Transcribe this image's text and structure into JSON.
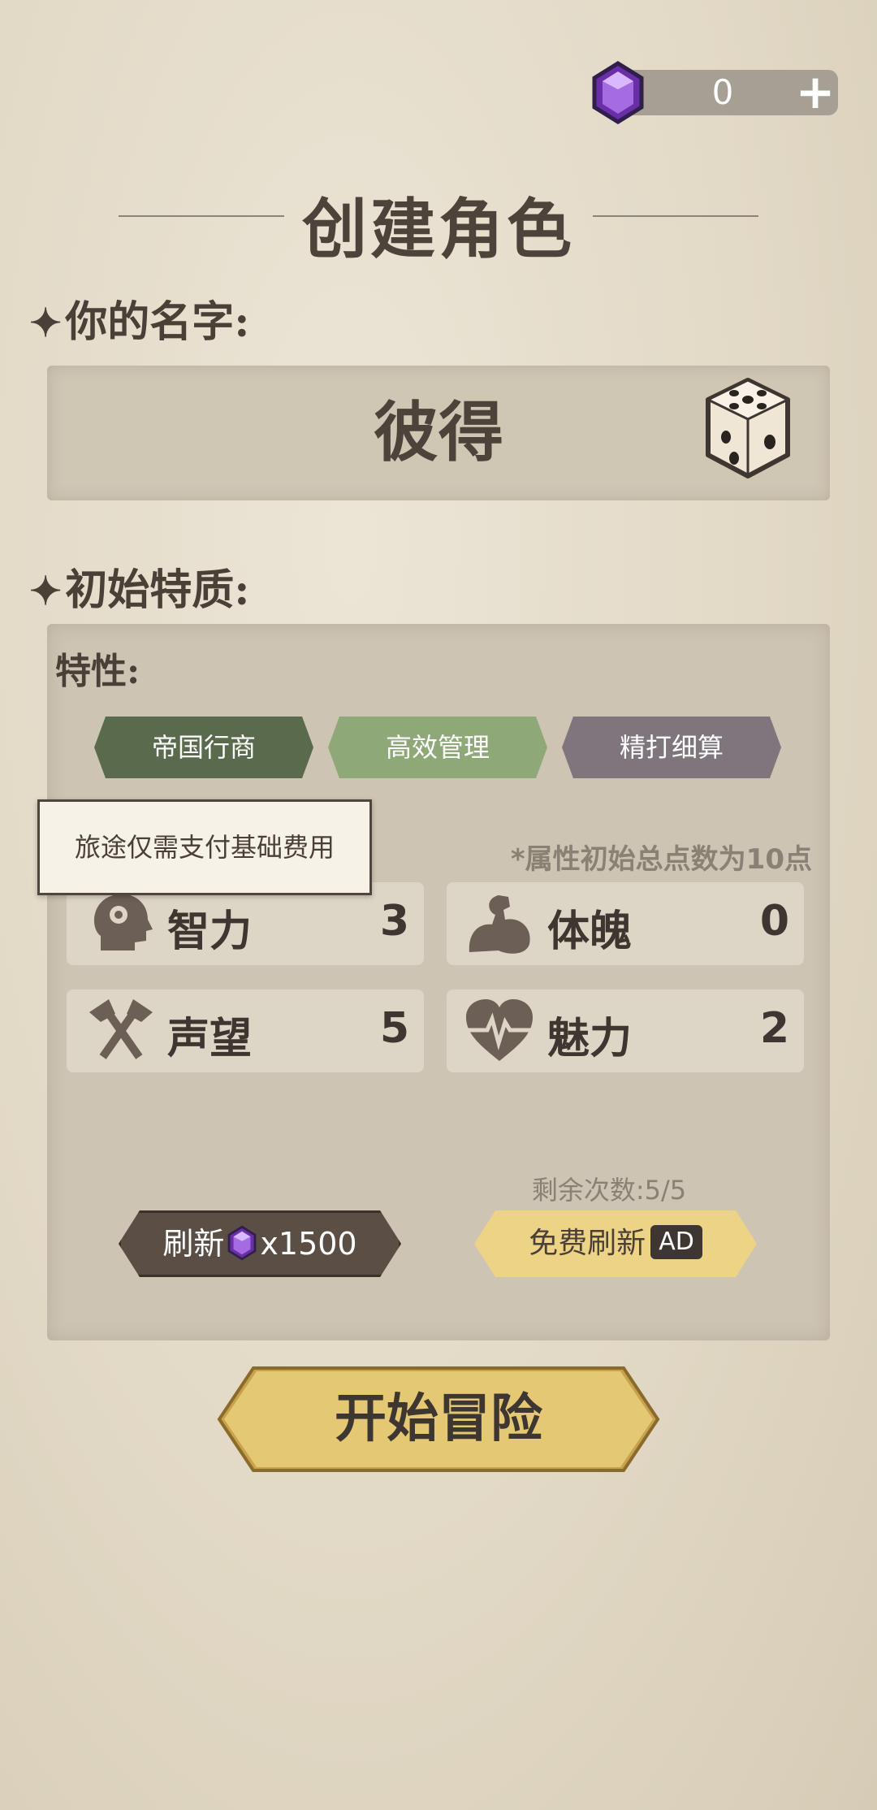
{
  "currency": {
    "count": "0",
    "plus": "+"
  },
  "title": "创建角色",
  "name_section": {
    "header": "你的名字:",
    "name": "彼得"
  },
  "traits_section": {
    "header": "初始特质:",
    "subheader": "特性:",
    "traits": [
      {
        "label": "帝国行商",
        "color": "#5a6b4d"
      },
      {
        "label": "高效管理",
        "color": "#8fa878"
      },
      {
        "label": "精打细算",
        "color": "#7e757d"
      }
    ],
    "tooltip": "旅途仅需支付基础费用",
    "note": "*属性初始总点数为10点",
    "stats": [
      {
        "name": "智力",
        "value": "3",
        "icon": "brain-head-icon"
      },
      {
        "name": "体魄",
        "value": "0",
        "icon": "muscle-arm-icon"
      },
      {
        "name": "声望",
        "value": "5",
        "icon": "crossed-axes-icon"
      },
      {
        "name": "魅力",
        "value": "2",
        "icon": "heartbeat-icon"
      }
    ],
    "remaining": "剩余次数:5/5",
    "refresh_button": {
      "label": "刷新",
      "cost": "x1500"
    },
    "free_refresh_button": {
      "label": "免费刷新",
      "badge": "AD"
    }
  },
  "start_button": "开始冒险"
}
